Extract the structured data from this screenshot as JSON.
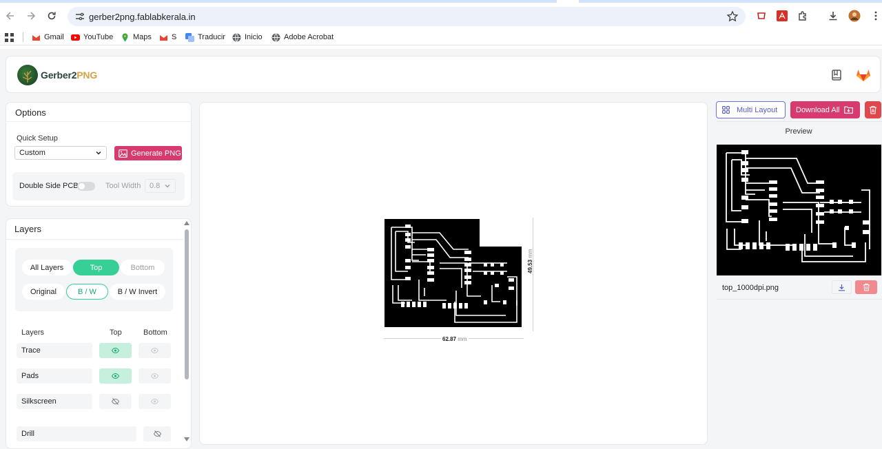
{
  "browser": {
    "url": "gerber2png.fablabkerala.in",
    "bookmarks": [
      {
        "label": "Gmail",
        "icon": "gmail-icon",
        "color": "#ea4335"
      },
      {
        "label": "YouTube",
        "icon": "youtube-icon",
        "color": "#ff0000"
      },
      {
        "label": "Maps",
        "icon": "maps-icon",
        "color": "#34a853"
      },
      {
        "label": "S",
        "icon": "gmail-icon",
        "color": "#ea4335"
      },
      {
        "label": "Traducir",
        "icon": "translate-icon",
        "color": "#4285f4"
      },
      {
        "label": "Inicio",
        "icon": "globe-icon",
        "color": "#5f6368"
      },
      {
        "label": "Adobe Acrobat",
        "icon": "globe-icon",
        "color": "#5f6368"
      }
    ]
  },
  "app": {
    "logo": {
      "name": "Gerber2",
      "accent": "PNG"
    },
    "accent_color": "#d73a6f",
    "green_color": "#36cf95"
  },
  "options": {
    "title": "Options",
    "quick_setup_label": "Quick Setup",
    "quick_setup_value": "Custom",
    "generate_label": "Generate PNG",
    "double_side_label": "Double Side PCB",
    "double_side_enabled": false,
    "tool_width_label": "Tool Width",
    "tool_width_value": "0.8"
  },
  "layers": {
    "title": "Layers",
    "view_tabs": [
      "All Layers",
      "Top",
      "Bottom"
    ],
    "view_selected": "Top",
    "mode_tabs": [
      "Original",
      "B / W",
      "B / W Invert"
    ],
    "mode_selected": "B / W",
    "table_headers": [
      "Layers",
      "Top",
      "Bottom"
    ],
    "rows": [
      {
        "name": "Trace",
        "top": "visible",
        "bottom": "disabled"
      },
      {
        "name": "Pads",
        "top": "visible",
        "bottom": "disabled"
      },
      {
        "name": "Silkscreen",
        "top": "hidden",
        "bottom": "disabled"
      },
      {
        "name": "Drill",
        "top": "hidden"
      }
    ]
  },
  "canvas": {
    "width_value": "62.87",
    "height_value": "49.53",
    "unit": "mm"
  },
  "right_panel": {
    "multi_layout_label": "Multi Layout",
    "download_all_label": "Download All",
    "preview_label": "Preview",
    "file_name": "top_1000dpi.png"
  }
}
